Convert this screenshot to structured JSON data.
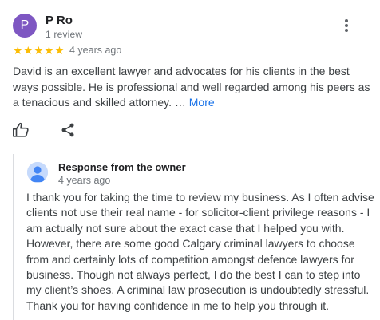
{
  "reviewer": {
    "initial": "P",
    "name": "P Ro",
    "review_count": "1 review",
    "avatar_color": "#7e57c2"
  },
  "rating": {
    "value": 5,
    "max": 5,
    "stars_text": "★★★★★",
    "star_color": "#fbbc04"
  },
  "review": {
    "age": "4 years ago",
    "text": "David is an excellent lawyer and advocates for his clients in the best ways possible. He is professional and well regarded among his peers as a tenacious and skilled attorney. … ",
    "more_label": "More"
  },
  "actions": {
    "like_icon": "thumbs-up-icon",
    "share_icon": "share-icon",
    "menu_icon": "more-vert-icon"
  },
  "owner_response": {
    "title": "Response from the owner",
    "age": "4 years ago",
    "text": "I thank you for taking the time to review my business. As I often advise clients not use their real name - for solicitor-client privilege reasons - I am actually not sure about the exact case that I helped you with. However, there are some good Calgary criminal lawyers to choose from and certainly lots of competition amongst defence lawyers for business. Though not always perfect, I do the best I can to step into my client’s shoes. A criminal law prosecution is undoubtedly stressful. Thank you for having confidence in me to help you through it."
  },
  "colors": {
    "link": "#1a73e8",
    "text": "#3c4043",
    "muted": "#70757a"
  }
}
